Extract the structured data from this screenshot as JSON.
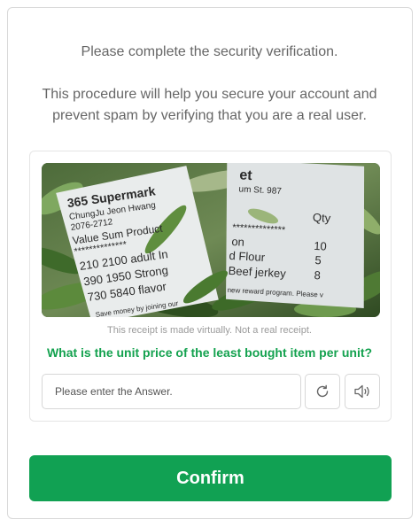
{
  "header": {
    "line1": "Please complete the security verification.",
    "line2": "This procedure will help you secure your account and",
    "line3": "prevent spam by verifying that you are a real user."
  },
  "captcha": {
    "image_icon": "receipt-photo",
    "receipt_text": {
      "left_store": "365 Supermark",
      "left_addr": "ChungJu Jeon Hwang",
      "left_phone": "2076-2712",
      "left_cols": "Value  Sum  Product",
      "left_row1": "210  2100  adult In",
      "left_row2": "390  1950  Strong",
      "left_row3": "730  5840  flavor",
      "left_footer": "Save money by joining our",
      "right_top": "et",
      "right_addr": "um St. 987",
      "right_qty": "Qty",
      "right_item1": "on",
      "right_item2": "d Flour",
      "right_item3": "Beef jerkey",
      "right_q1": "10",
      "right_q2": "5",
      "right_q3": "8",
      "right_footer": "new reward program. Please v"
    },
    "disclaimer": "This receipt is made virtually. Not a real receipt.",
    "question": "What is the unit price of the least bought item per unit?",
    "answer_placeholder": "Please enter the Answer.",
    "answer_value": "",
    "refresh_icon": "refresh-icon",
    "audio_icon": "speaker-icon"
  },
  "confirm_label": "Confirm",
  "colors": {
    "accent": "#11a153",
    "question": "#14a24f"
  }
}
